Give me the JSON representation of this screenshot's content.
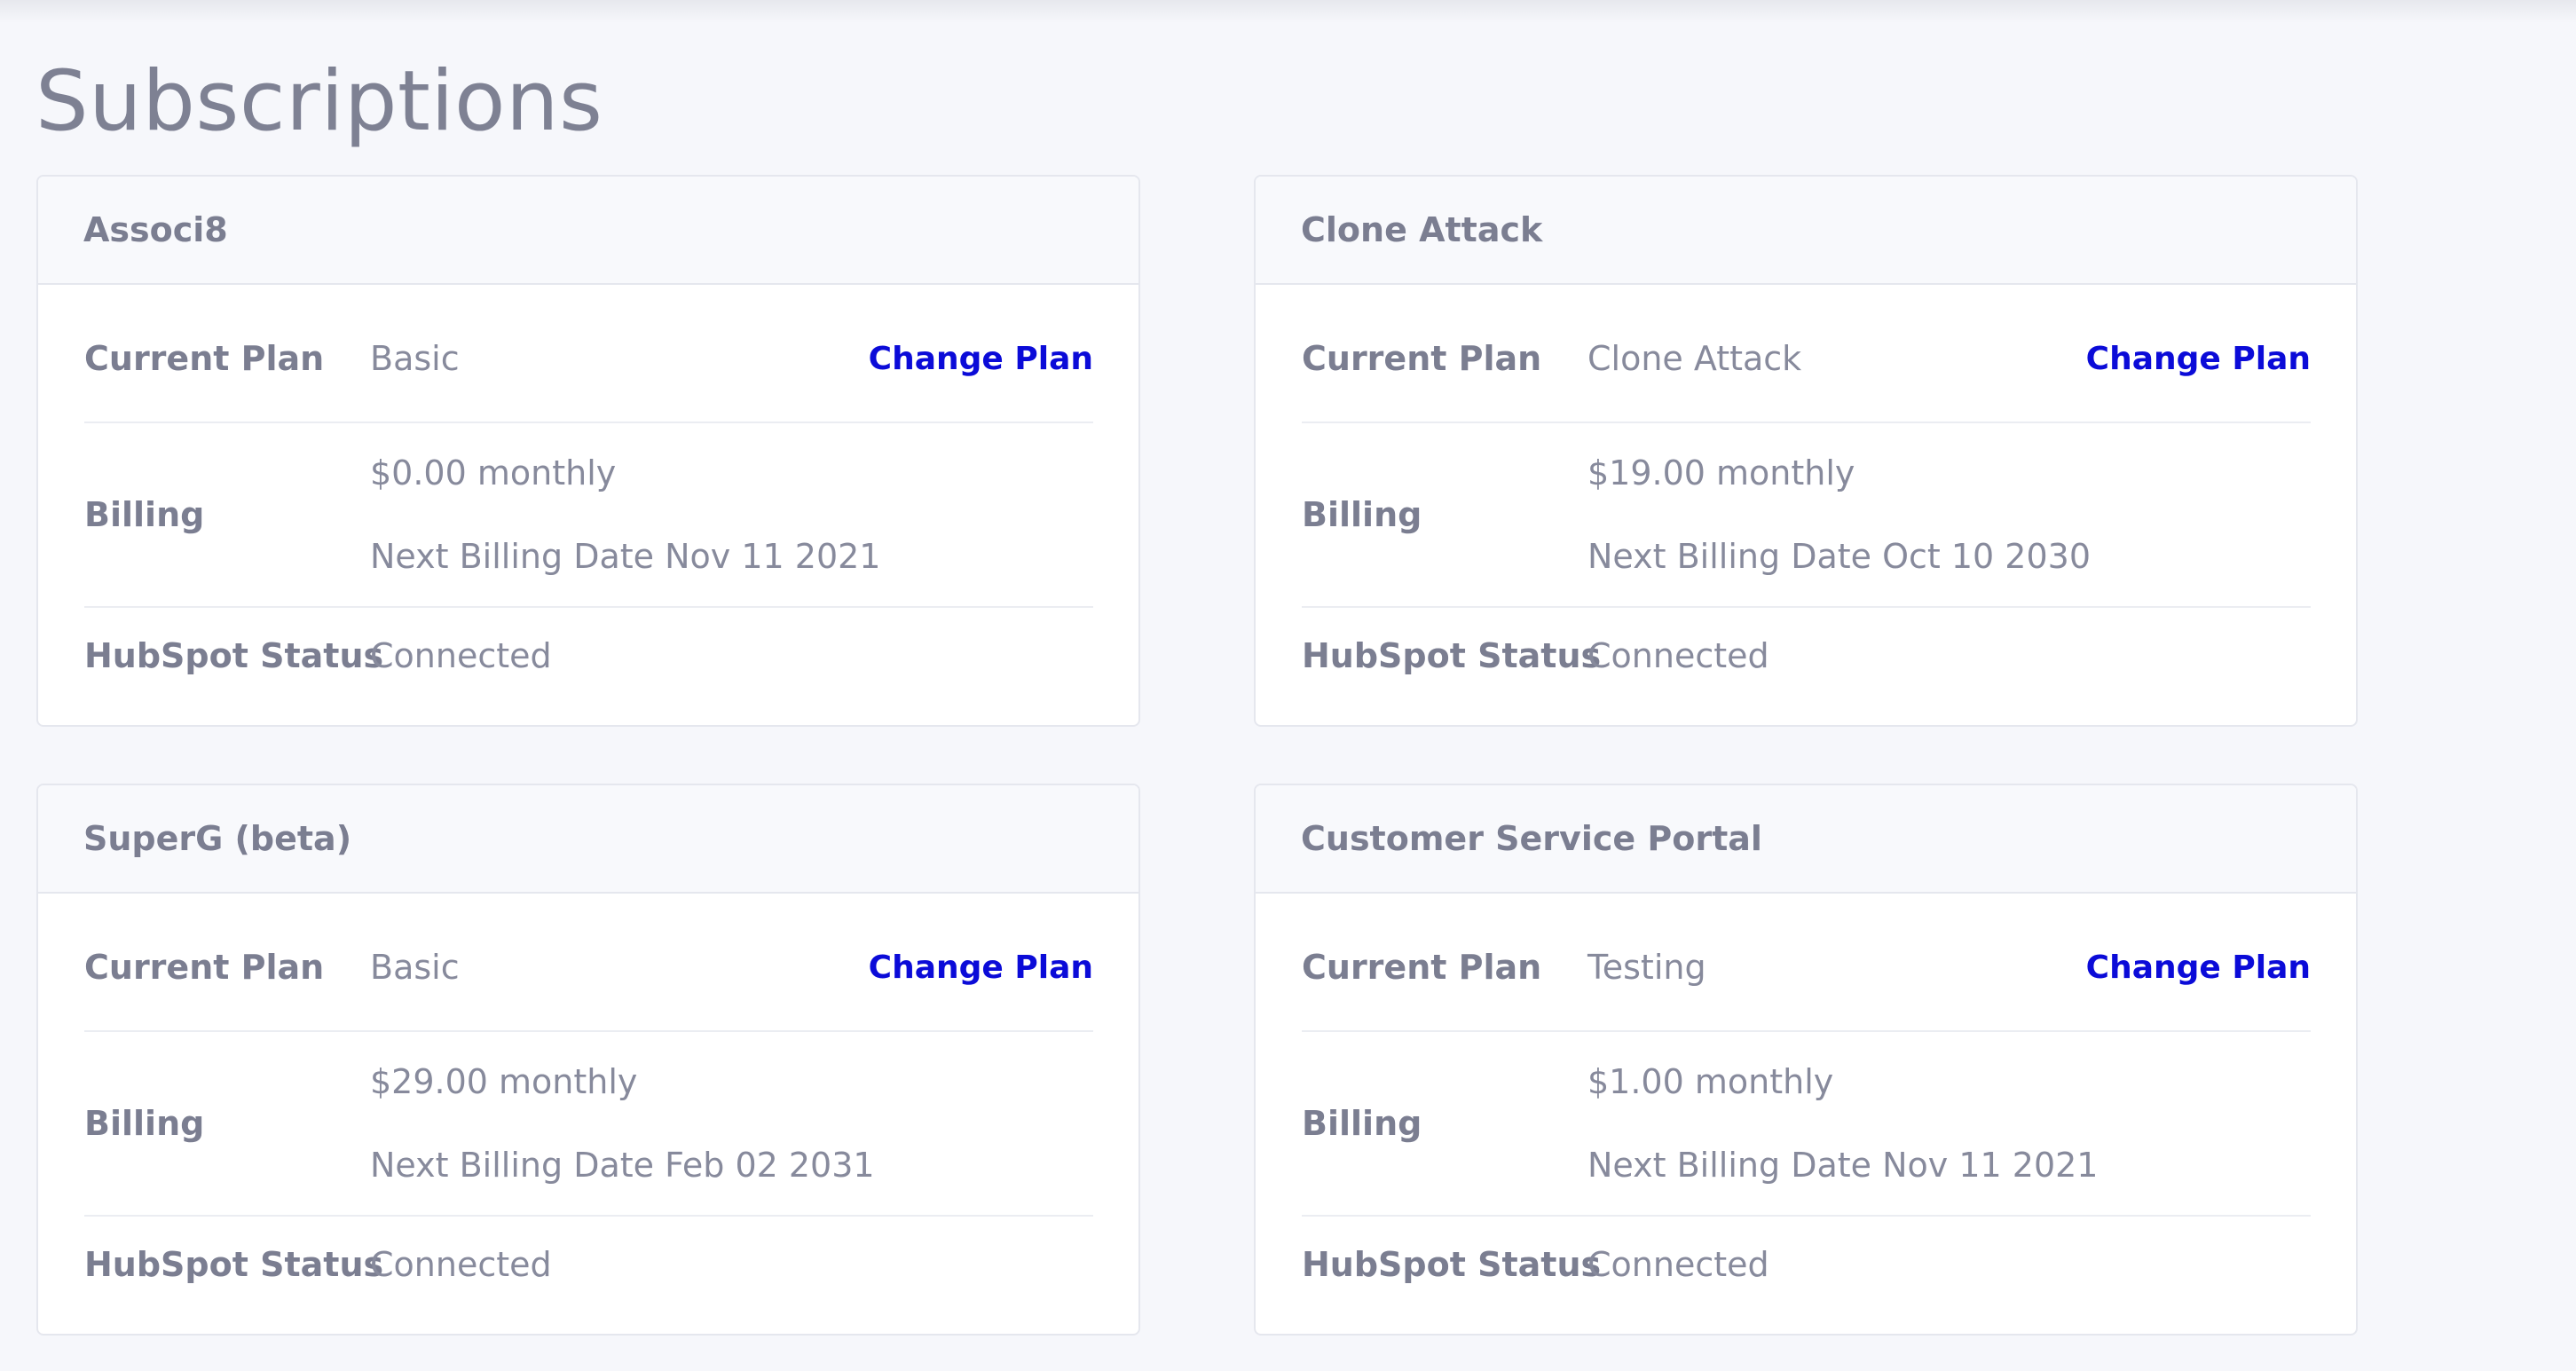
{
  "page": {
    "title": "Subscriptions"
  },
  "labels": {
    "current_plan": "Current Plan",
    "billing": "Billing",
    "hubspot_status": "HubSpot Status",
    "change_plan": "Change Plan"
  },
  "colors": {
    "link": "#0b0bd8",
    "background": "#f6f7fb",
    "card_header": "#f8f9fc"
  },
  "subscriptions": [
    {
      "name": "Associ8",
      "current_plan": "Basic",
      "billing_amount": "$0.00 monthly",
      "next_billing": "Next Billing Date Nov 11 2021",
      "hubspot_status": "Connected"
    },
    {
      "name": "Clone Attack",
      "current_plan": "Clone Attack",
      "billing_amount": "$19.00 monthly",
      "next_billing": "Next Billing Date Oct 10 2030",
      "hubspot_status": "Connected"
    },
    {
      "name": "SuperG (beta)",
      "current_plan": "Basic",
      "billing_amount": "$29.00 monthly",
      "next_billing": "Next Billing Date Feb 02 2031",
      "hubspot_status": "Connected"
    },
    {
      "name": "Customer Service Portal",
      "current_plan": "Testing",
      "billing_amount": "$1.00 monthly",
      "next_billing": "Next Billing Date Nov 11 2021",
      "hubspot_status": "Connected"
    }
  ]
}
